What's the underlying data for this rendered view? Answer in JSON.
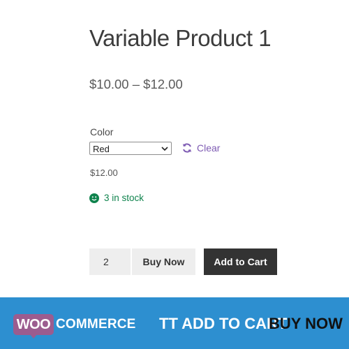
{
  "product": {
    "title": "Variable Product 1",
    "price_range": "$10.00 – $12.00",
    "attribute_label": "Color",
    "selected_color": "Red",
    "clear_label": "Clear",
    "variant_price": "$12.00",
    "stock_text": "3 in stock",
    "quantity": "2",
    "buy_now_label": "Buy Now",
    "add_to_cart_label": "Add to Cart"
  },
  "banner": {
    "woo": "WOO",
    "commerce": "COMMERCE",
    "tagline": "TT ADD TO CART",
    "tagline_highlight": "BUY NOW"
  },
  "colors": {
    "accent_purple": "#7e5bb3",
    "stock_green": "#0f834d",
    "banner_blue": "#2d8fd0",
    "woo_purple": "#9b5c8f",
    "cart_button": "#333333"
  },
  "icons": {
    "clear": "refresh-icon",
    "stock": "smiley-icon",
    "select": "chevron-down-icon"
  }
}
